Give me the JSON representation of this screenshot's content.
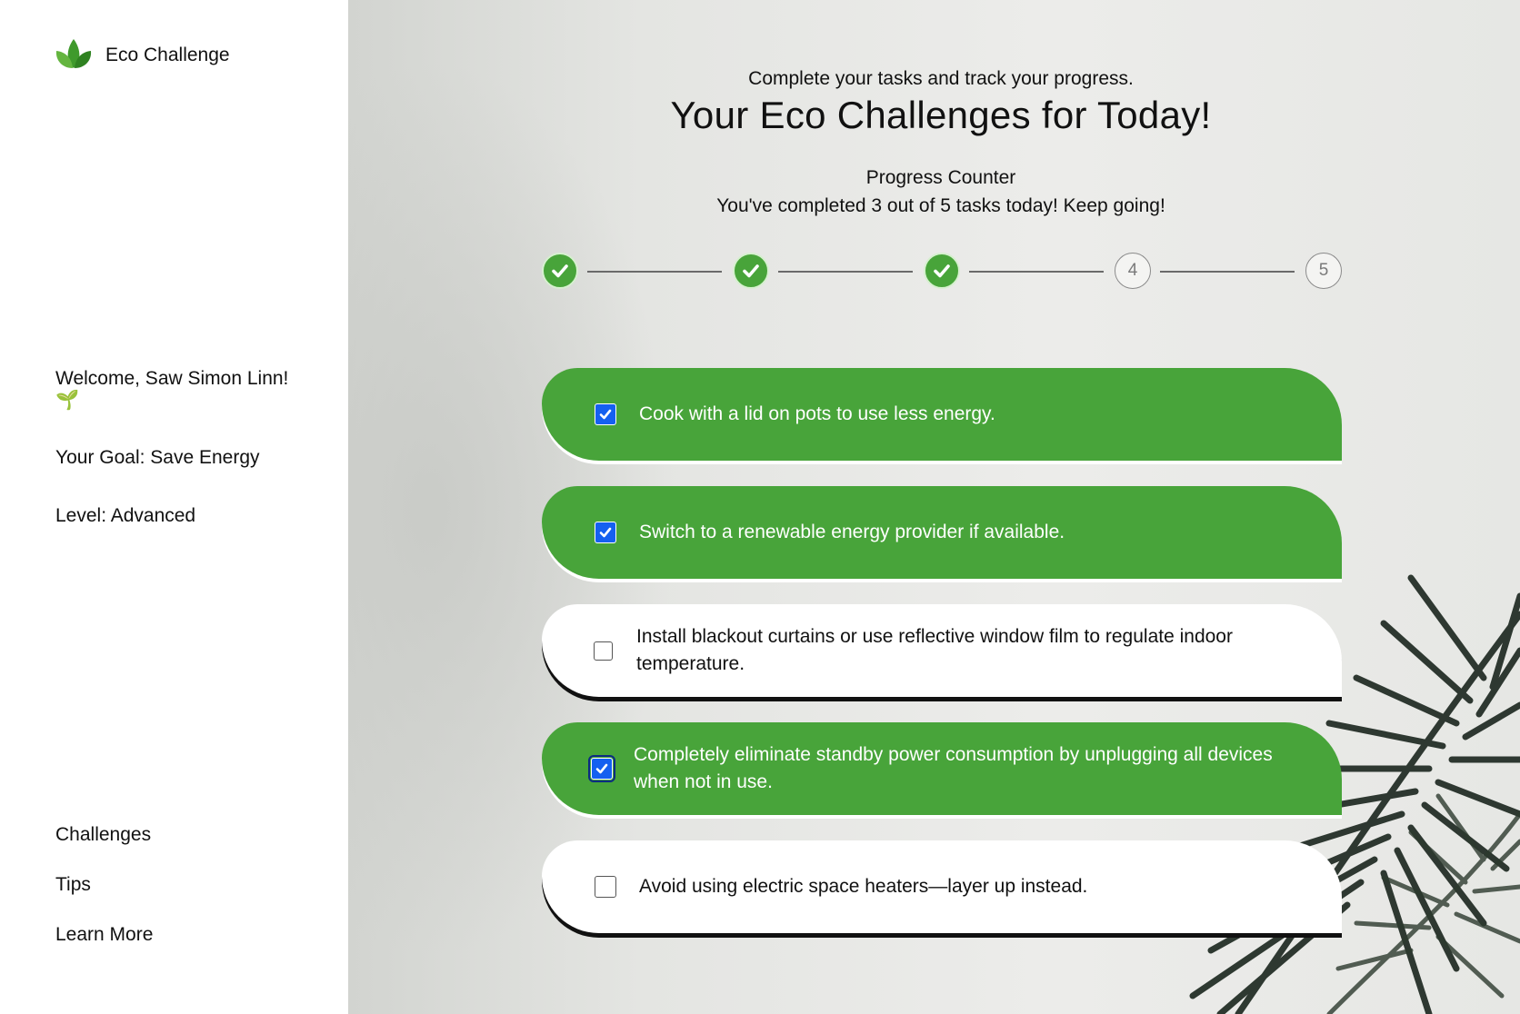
{
  "sidebar": {
    "brand": {
      "title": "Eco Challenge",
      "icon": "leaf-icon"
    },
    "welcome": "Welcome, Saw Simon Linn! 🌱",
    "goal": "Your Goal: Save Energy",
    "level": "Level: Advanced",
    "nav": [
      {
        "label": "Challenges"
      },
      {
        "label": "Tips"
      },
      {
        "label": "Learn More"
      }
    ]
  },
  "main": {
    "subtitle": "Complete your tasks and track your progress.",
    "title": "Your Eco Challenges for Today!",
    "progress_label": "Progress Counter",
    "progress_message": "You've completed 3 out of 5 tasks today! Keep going!",
    "progress": {
      "completed": 3,
      "total": 5
    },
    "steps": [
      {
        "label": "1",
        "done": true
      },
      {
        "label": "2",
        "done": true
      },
      {
        "label": "3",
        "done": true
      },
      {
        "label": "4",
        "done": false
      },
      {
        "label": "5",
        "done": false
      }
    ],
    "tasks": [
      {
        "text": "Cook with a lid on pots to use less energy.",
        "checked": true
      },
      {
        "text": "Switch to a renewable energy provider if available.",
        "checked": true
      },
      {
        "text": "Install blackout curtains or use reflective window film to regulate indoor temperature.",
        "checked": false
      },
      {
        "text": "Completely eliminate standby power consumption by unplugging all devices when not in use.",
        "checked": true
      },
      {
        "text": "Avoid using electric space heaters—layer up instead.",
        "checked": false
      }
    ]
  },
  "colors": {
    "accent_green": "#48a43a",
    "checkbox_blue": "#1560f0",
    "sidebar_bg": "#ffffff"
  }
}
